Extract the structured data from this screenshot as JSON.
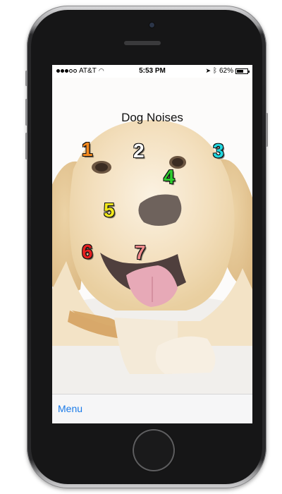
{
  "status_bar": {
    "carrier": "AT&T",
    "time": "5:53 PM",
    "battery_percent": "62%",
    "battery_level": 0.62,
    "signal_bars": 3,
    "signal_max": 5
  },
  "screen": {
    "title": "Dog Noises"
  },
  "sound_buttons": [
    {
      "label": "1",
      "color": "#f58a1f"
    },
    {
      "label": "2",
      "color": "#ffffff"
    },
    {
      "label": "3",
      "color": "#20d8e0"
    },
    {
      "label": "4",
      "color": "#2ecc2e"
    },
    {
      "label": "5",
      "color": "#f2e81c"
    },
    {
      "label": "6",
      "color": "#e62020"
    },
    {
      "label": "7",
      "color": "#f08a8a"
    }
  ],
  "toolbar": {
    "menu_label": "Menu"
  },
  "colors": {
    "link_blue": "#1a7ae8",
    "phone_body": "#1c1c1e"
  }
}
